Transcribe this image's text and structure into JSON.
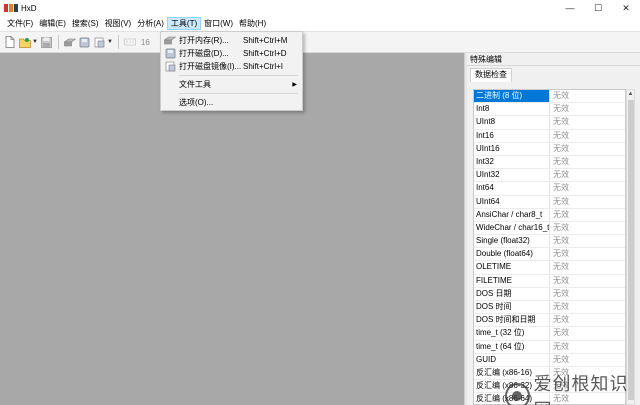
{
  "window": {
    "title": "HxD",
    "controls": {
      "minimize": "—",
      "maximize": "☐",
      "close": "✕"
    }
  },
  "menubar": {
    "items": [
      "文件(F)",
      "编辑(E)",
      "搜索(S)",
      "视图(V)",
      "分析(A)",
      "工具(T)",
      "窗口(W)",
      "帮助(H)"
    ],
    "active_index": 5
  },
  "toolbar": {
    "bytes_per_row": "16"
  },
  "tools_menu": {
    "items": [
      {
        "label": "打开内存(R)...",
        "shortcut": "Shift+Ctrl+M",
        "icon": "ram-icon"
      },
      {
        "label": "打开磁盘(D)...",
        "shortcut": "Shift+Ctrl+D",
        "icon": "disk-icon"
      },
      {
        "label": "打开磁盘镜像(I)...",
        "shortcut": "Shift+Ctrl+I",
        "icon": "disk-image-icon"
      }
    ],
    "file_tools": "文件工具",
    "options": "选项(O)..."
  },
  "panel": {
    "title": "特殊编辑",
    "tab": "数据检查",
    "selected_index": 0,
    "rows": [
      {
        "name": "二进制 (8 位)",
        "value": "无效"
      },
      {
        "name": "Int8",
        "value": "无效"
      },
      {
        "name": "UInt8",
        "value": "无效"
      },
      {
        "name": "Int16",
        "value": "无效"
      },
      {
        "name": "UInt16",
        "value": "无效"
      },
      {
        "name": "Int32",
        "value": "无效"
      },
      {
        "name": "UInt32",
        "value": "无效"
      },
      {
        "name": "Int64",
        "value": "无效"
      },
      {
        "name": "UInt64",
        "value": "无效"
      },
      {
        "name": "AnsiChar / char8_t",
        "value": "无效"
      },
      {
        "name": "WideChar / char16_t",
        "value": "无效"
      },
      {
        "name": "Single (float32)",
        "value": "无效"
      },
      {
        "name": "Double (float64)",
        "value": "无效"
      },
      {
        "name": "OLETIME",
        "value": "无效"
      },
      {
        "name": "FILETIME",
        "value": "无效"
      },
      {
        "name": "DOS 日期",
        "value": "无效"
      },
      {
        "name": "DOS 时间",
        "value": "无效"
      },
      {
        "name": "DOS 时间和日期",
        "value": "无效"
      },
      {
        "name": "time_t (32 位)",
        "value": "无效"
      },
      {
        "name": "time_t (64 位)",
        "value": "无效"
      },
      {
        "name": "GUID",
        "value": "无效"
      },
      {
        "name": "反汇编 (x86-16)",
        "value": "无效"
      },
      {
        "name": "反汇编 (x86-32)",
        "value": "无效"
      },
      {
        "name": "反汇编 (x86-64)",
        "value": "无效"
      }
    ]
  },
  "watermark": "爱创根知识网",
  "colors": {
    "workspace": "#a8a8a8",
    "selection": "#0078d7",
    "menu_active": "#cce8ff"
  }
}
